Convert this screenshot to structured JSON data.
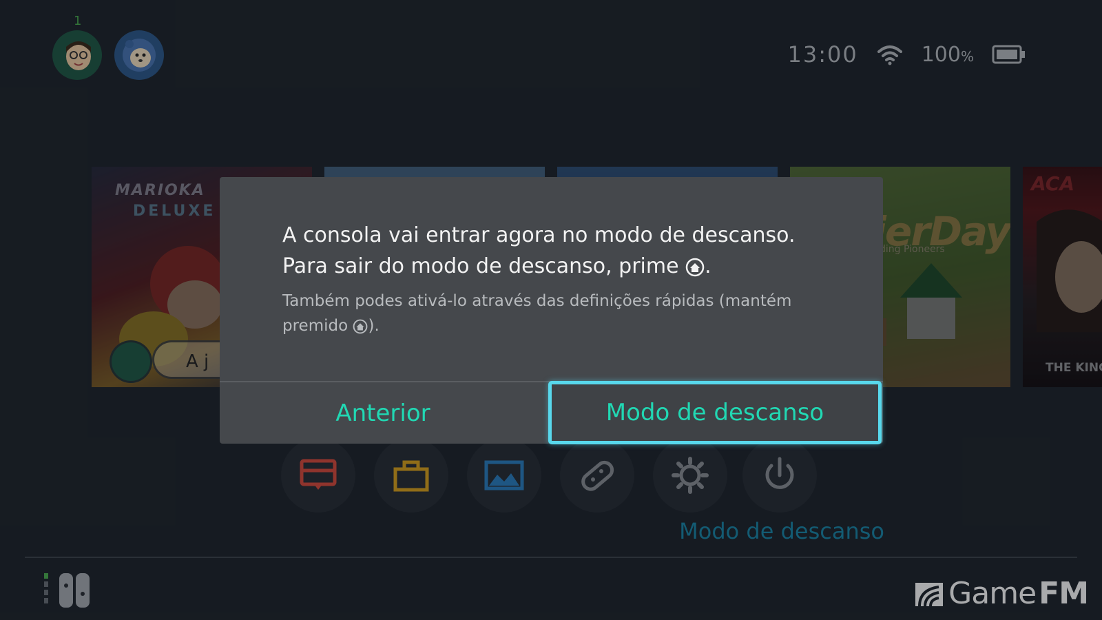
{
  "status_bar": {
    "user_count": "1",
    "time": "13:00",
    "battery_percent": "100",
    "battery_unit": "%",
    "icons": [
      "wifi-icon",
      "battery-icon"
    ]
  },
  "tiles": [
    {
      "logo": "MARIOKA",
      "sub": "DELUXE",
      "pill_text": "A j"
    },
    {
      "logo": ""
    },
    {
      "logo": ""
    },
    {
      "logo": "ierDays",
      "sub": "ding Pioneers"
    },
    {
      "logo": "ACA",
      "sub": "THE KING"
    }
  ],
  "dock": {
    "icons": [
      "news-icon",
      "shop-icon",
      "album-icon",
      "controllers-icon",
      "settings-icon",
      "power-icon"
    ],
    "selected_label": "Modo de descanso",
    "colors": {
      "news": "#d84a3c",
      "shop": "#d9a21c",
      "album": "#2a7fc0",
      "gray": "#8a9096"
    }
  },
  "dialog": {
    "line1": "A consola vai entrar agora no modo de descanso.",
    "line2_prefix": "Para sair do modo de descanso, prime ",
    "line2_suffix": ".",
    "sub_prefix": "Também podes ativá-lo através das definições rápidas (mantém premido ",
    "sub_suffix": ").",
    "buttons": {
      "previous": "Anterior",
      "sleep": "Modo de descanso"
    },
    "colors": {
      "button_text": "#21d8b3",
      "focus_border": "#58d8ec"
    }
  },
  "watermark": {
    "part1": "Game",
    "part2": "FM"
  }
}
